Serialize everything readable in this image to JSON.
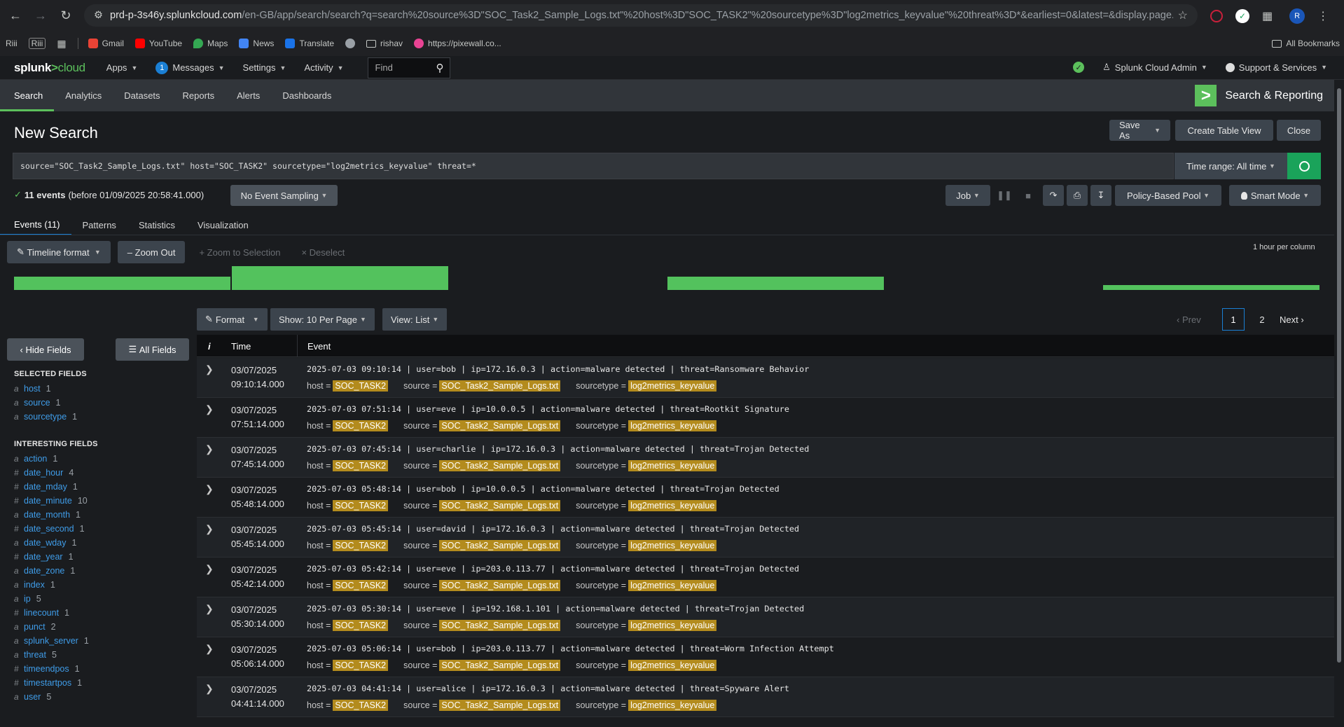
{
  "browser": {
    "url_host": "prd-p-3s46y.splunkcloud.com",
    "url_path": "/en-GB/app/search/search?q=search%20source%3D\"SOC_Task2_Sample_Logs.txt\"%20host%3D\"SOC_TASK2\"%20sourcetype%3D\"log2metrics_keyvalue\"%20threat%3D*&earliest=0&latest=&display.page.search.mod...",
    "profile_initial": "R",
    "bookmarks": [
      "Riii",
      "Riii",
      "Gmail",
      "YouTube",
      "Maps",
      "News",
      "Translate",
      "rishav",
      "https://pixewall.co..."
    ],
    "all_bookmarks": "All Bookmarks"
  },
  "splunk_bar": {
    "logo_main": "splunk",
    "logo_gt": ">",
    "logo_cloud": "cloud",
    "apps": "Apps",
    "messages_count": "1",
    "messages": "Messages",
    "settings": "Settings",
    "activity": "Activity",
    "find_placeholder": "Find",
    "user": "Splunk Cloud Admin",
    "support": "Support & Services"
  },
  "appbar": {
    "tabs": [
      "Search",
      "Analytics",
      "Datasets",
      "Reports",
      "Alerts",
      "Dashboards"
    ],
    "app_name": "Search & Reporting"
  },
  "page": {
    "title": "New Search",
    "save_as": "Save As",
    "create_table_view": "Create Table View",
    "close": "Close",
    "query": "source=\"SOC_Task2_Sample_Logs.txt\" host=\"SOC_TASK2\" sourcetype=\"log2metrics_keyvalue\" threat=*",
    "time_range": "Time range: All time",
    "events_count": "11 events",
    "events_before": "(before 01/09/2025 20:58:41.000)",
    "sampling": "No Event Sampling",
    "job": "Job",
    "policy_pool": "Policy-Based Pool",
    "smart_mode": "Smart Mode"
  },
  "subtabs": [
    "Events (11)",
    "Patterns",
    "Statistics",
    "Visualization"
  ],
  "timeline": {
    "format": "Timeline format",
    "zoom_out": "Zoom Out",
    "zoom_selection": "Zoom to Selection",
    "deselect": "Deselect",
    "scale": "1 hour per column",
    "bar_levels": [
      0.55,
      1.0,
      0.0,
      0.55,
      0.0,
      0.2
    ]
  },
  "results_controls": {
    "format": "Format",
    "per_page": "Show: 10 Per Page",
    "view": "View: List",
    "prev": "Prev",
    "page_current": "1",
    "page_2": "2",
    "next": "Next"
  },
  "sidebar": {
    "hide_fields": "Hide Fields",
    "all_fields": "All Fields",
    "selected_header": "SELECTED FIELDS",
    "selected": [
      {
        "type": "a",
        "name": "host",
        "count": "1"
      },
      {
        "type": "a",
        "name": "source",
        "count": "1"
      },
      {
        "type": "a",
        "name": "sourcetype",
        "count": "1"
      }
    ],
    "interesting_header": "INTERESTING FIELDS",
    "interesting": [
      {
        "type": "a",
        "name": "action",
        "count": "1"
      },
      {
        "type": "#",
        "name": "date_hour",
        "count": "4"
      },
      {
        "type": "#",
        "name": "date_mday",
        "count": "1"
      },
      {
        "type": "#",
        "name": "date_minute",
        "count": "10"
      },
      {
        "type": "a",
        "name": "date_month",
        "count": "1"
      },
      {
        "type": "#",
        "name": "date_second",
        "count": "1"
      },
      {
        "type": "a",
        "name": "date_wday",
        "count": "1"
      },
      {
        "type": "#",
        "name": "date_year",
        "count": "1"
      },
      {
        "type": "a",
        "name": "date_zone",
        "count": "1"
      },
      {
        "type": "a",
        "name": "index",
        "count": "1"
      },
      {
        "type": "a",
        "name": "ip",
        "count": "5"
      },
      {
        "type": "#",
        "name": "linecount",
        "count": "1"
      },
      {
        "type": "a",
        "name": "punct",
        "count": "2"
      },
      {
        "type": "a",
        "name": "splunk_server",
        "count": "1"
      },
      {
        "type": "a",
        "name": "threat",
        "count": "5"
      },
      {
        "type": "#",
        "name": "timeendpos",
        "count": "1"
      },
      {
        "type": "#",
        "name": "timestartpos",
        "count": "1"
      },
      {
        "type": "a",
        "name": "user",
        "count": "5"
      }
    ]
  },
  "table": {
    "col_info": "i",
    "col_time": "Time",
    "col_event": "Event",
    "host_key": "host =",
    "source_key": "source =",
    "sourcetype_key": "sourcetype =",
    "host_val": "SOC_TASK2",
    "source_val": "SOC_Task2_Sample_Logs.txt",
    "sourcetype_val": "log2metrics_keyvalue",
    "rows": [
      {
        "date": "03/07/2025",
        "time": "09:10:14.000",
        "raw": "2025-07-03 09:10:14 | user=bob | ip=172.16.0.3 | action=malware detected | threat=Ransomware Behavior"
      },
      {
        "date": "03/07/2025",
        "time": "07:51:14.000",
        "raw": "2025-07-03 07:51:14 | user=eve | ip=10.0.0.5 | action=malware detected | threat=Rootkit Signature"
      },
      {
        "date": "03/07/2025",
        "time": "07:45:14.000",
        "raw": "2025-07-03 07:45:14 | user=charlie | ip=172.16.0.3 | action=malware detected | threat=Trojan Detected"
      },
      {
        "date": "03/07/2025",
        "time": "05:48:14.000",
        "raw": "2025-07-03 05:48:14 | user=bob | ip=10.0.0.5 | action=malware detected | threat=Trojan Detected"
      },
      {
        "date": "03/07/2025",
        "time": "05:45:14.000",
        "raw": "2025-07-03 05:45:14 | user=david | ip=172.16.0.3 | action=malware detected | threat=Trojan Detected"
      },
      {
        "date": "03/07/2025",
        "time": "05:42:14.000",
        "raw": "2025-07-03 05:42:14 | user=eve | ip=203.0.113.77 | action=malware detected | threat=Trojan Detected"
      },
      {
        "date": "03/07/2025",
        "time": "05:30:14.000",
        "raw": "2025-07-03 05:30:14 | user=eve | ip=192.168.1.101 | action=malware detected | threat=Trojan Detected"
      },
      {
        "date": "03/07/2025",
        "time": "05:06:14.000",
        "raw": "2025-07-03 05:06:14 | user=bob | ip=203.0.113.77 | action=malware detected | threat=Worm Infection Attempt"
      },
      {
        "date": "03/07/2025",
        "time": "04:41:14.000",
        "raw": "2025-07-03 04:41:14 | user=alice | ip=172.16.0.3 | action=malware detected | threat=Spyware Alert"
      }
    ]
  }
}
